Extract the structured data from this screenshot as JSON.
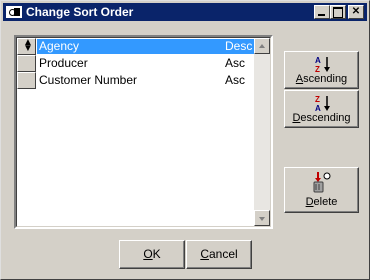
{
  "window": {
    "title": "Change Sort Order"
  },
  "sort_fields": [
    {
      "name": "Agency",
      "direction": "Desc",
      "selected": true
    },
    {
      "name": "Producer",
      "direction": "Asc",
      "selected": false
    },
    {
      "name": "Customer Number",
      "direction": "Asc",
      "selected": false
    }
  ],
  "buttons": {
    "ascending": {
      "mnemonic": "A",
      "rest": "scending"
    },
    "descending": {
      "mnemonic": "D",
      "rest": "escending"
    },
    "delete": {
      "mnemonic": "D",
      "rest": "elete"
    },
    "ok": {
      "mnemonic": "O",
      "rest": "K"
    },
    "cancel": {
      "mnemonic": "C",
      "rest": "ancel"
    }
  },
  "icons": {
    "ascending": "sort-az-icon",
    "descending": "sort-za-icon",
    "delete": "delete-icon",
    "row_handle": "up-down-arrows-icon"
  },
  "colors": {
    "titlebar": "#0a246a",
    "selection": "#3399ff",
    "face": "#d4d0c8"
  }
}
